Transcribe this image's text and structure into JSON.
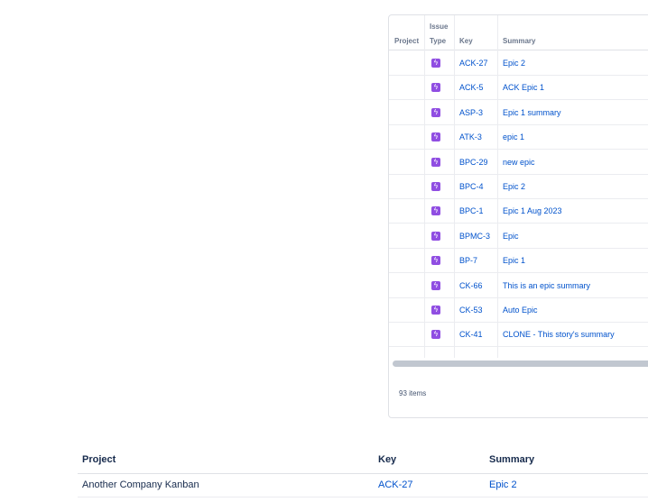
{
  "epic_table": {
    "headers": {
      "project": "Project",
      "issue_type_1": "Issue",
      "issue_type_2": "Type",
      "key": "Key",
      "summary": "Summary"
    },
    "rows": [
      {
        "key": "ACK-27",
        "summary": "Epic 2"
      },
      {
        "key": "ACK-5",
        "summary": "ACK Epic 1"
      },
      {
        "key": "ASP-3",
        "summary": "Epic 1 summary"
      },
      {
        "key": "ATK-3",
        "summary": "epic 1"
      },
      {
        "key": "BPC-29",
        "summary": "new epic"
      },
      {
        "key": "BPC-4",
        "summary": "Epic 2"
      },
      {
        "key": "BPC-1",
        "summary": "Epic 1 Aug 2023"
      },
      {
        "key": "BPMC-3",
        "summary": "Epic"
      },
      {
        "key": "BP-7",
        "summary": "Epic 1"
      },
      {
        "key": "CK-66",
        "summary": "This is an epic summary"
      },
      {
        "key": "CK-53",
        "summary": "Auto Epic"
      },
      {
        "key": "CK-41",
        "summary": "CLONE - This story's summary"
      }
    ],
    "item_count": "93 items",
    "epic_icon": "epic-lightning-icon",
    "epic_color": "#904ee2",
    "link_color": "#0052cc"
  },
  "bottom_table": {
    "headers": {
      "project": "Project",
      "key": "Key",
      "summary": "Summary"
    },
    "rows": [
      {
        "project": "Another Company Kanban",
        "key": "ACK-27",
        "summary": "Epic 2"
      }
    ]
  }
}
